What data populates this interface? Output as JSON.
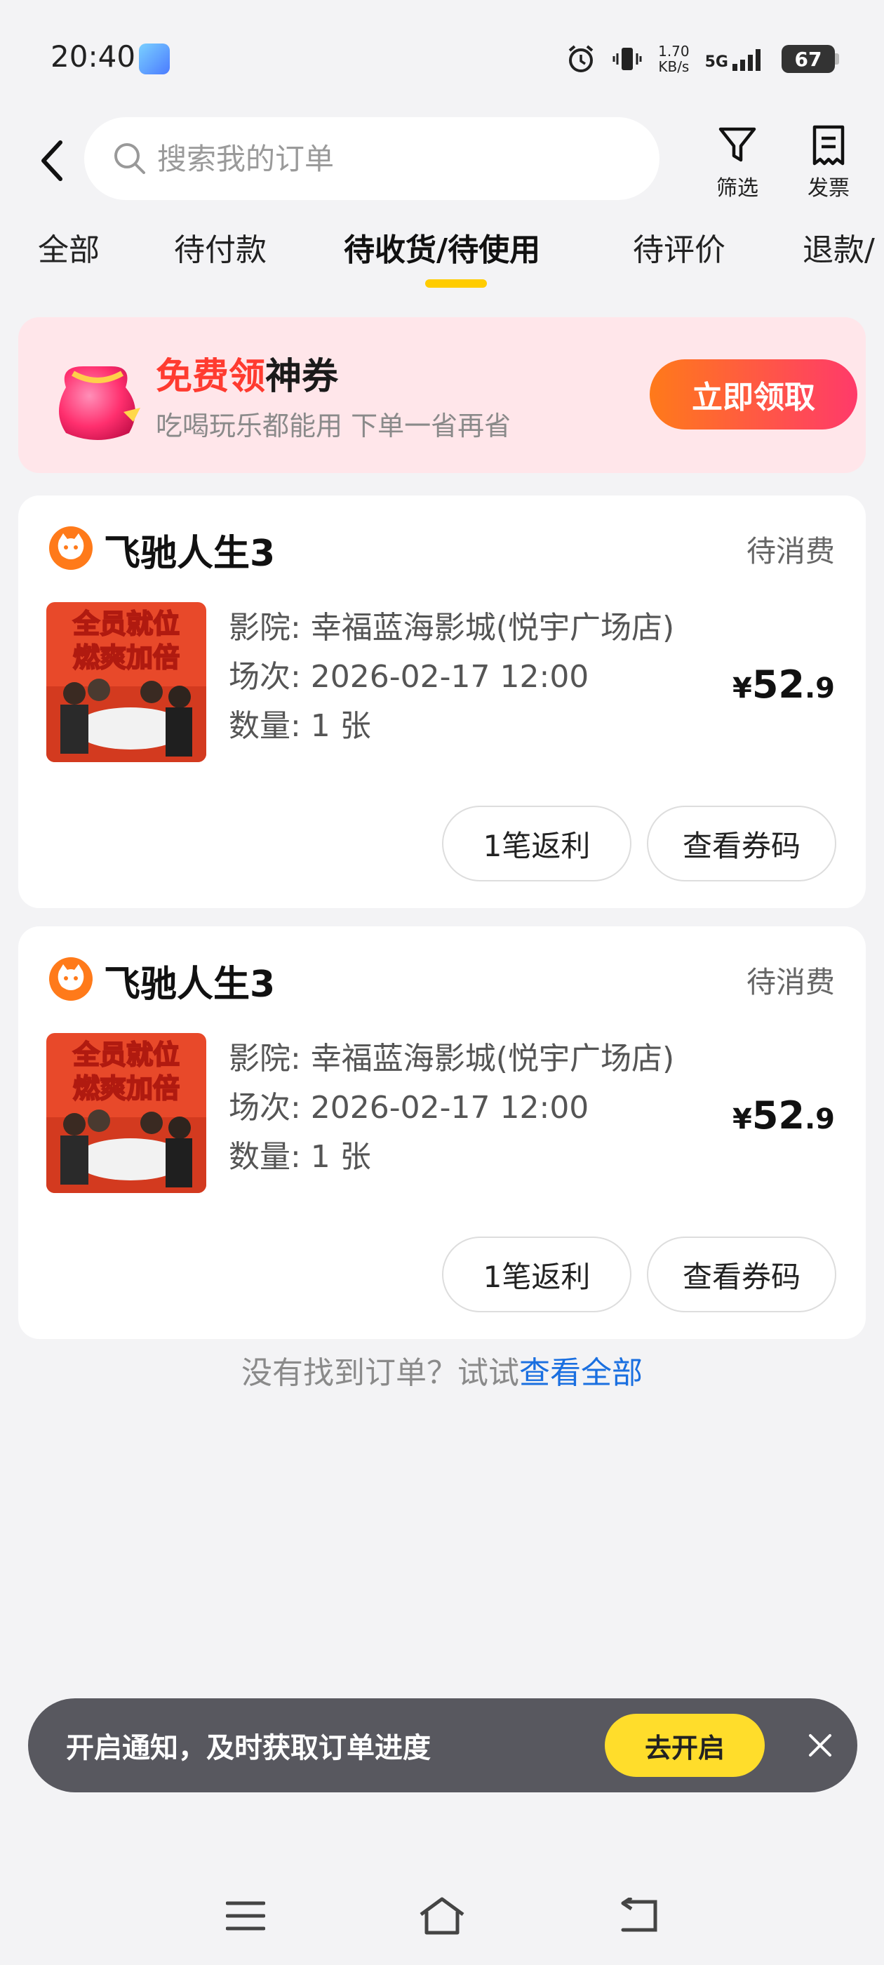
{
  "status_bar": {
    "time": "20:40",
    "net_speed_value": "1.70",
    "net_speed_unit": "KB/s",
    "network": "5G",
    "battery": "67"
  },
  "header": {
    "search_placeholder": "搜索我的订单",
    "filter_label": "筛选",
    "invoice_label": "发票"
  },
  "tabs": [
    {
      "label": "全部"
    },
    {
      "label": "待付款"
    },
    {
      "label": "待收货/待使用",
      "active": true
    },
    {
      "label": "待评价"
    },
    {
      "label": "退款/"
    }
  ],
  "promo": {
    "title_highlight": "免费领",
    "title_rest": "神券",
    "subtitle": "吃喝玩乐都能用 下单一省再省",
    "button": "立即领取"
  },
  "orders": [
    {
      "title": "飞驰人生3",
      "status": "待消费",
      "cinema": "影院: 幸福蓝海影城(悦宇广场店)",
      "session": "场次: 2026-02-17 12:00",
      "quantity": "数量: 1 张",
      "price_symbol": "¥",
      "price_int": "52",
      "price_dec": ".9",
      "poster_text_1": "全员就位",
      "poster_text_2": "燃爽加倍",
      "rebate_button": "1笔返利",
      "code_button": "查看券码"
    },
    {
      "title": "飞驰人生3",
      "status": "待消费",
      "cinema": "影院: 幸福蓝海影城(悦宇广场店)",
      "session": "场次: 2026-02-17 12:00",
      "quantity": "数量: 1 张",
      "price_symbol": "¥",
      "price_int": "52",
      "price_dec": ".9",
      "poster_text_1": "全员就位",
      "poster_text_2": "燃爽加倍",
      "rebate_button": "1笔返利",
      "code_button": "查看券码"
    }
  ],
  "footer_hint": {
    "text": "没有找到订单？试试",
    "link": "查看全部"
  },
  "notify": {
    "text": "开启通知，及时获取订单进度",
    "button": "去开启"
  },
  "colors": {
    "accent_yellow": "#ffcc00",
    "promo_red": "#ff3b30",
    "link_blue": "#1a6fe0"
  }
}
